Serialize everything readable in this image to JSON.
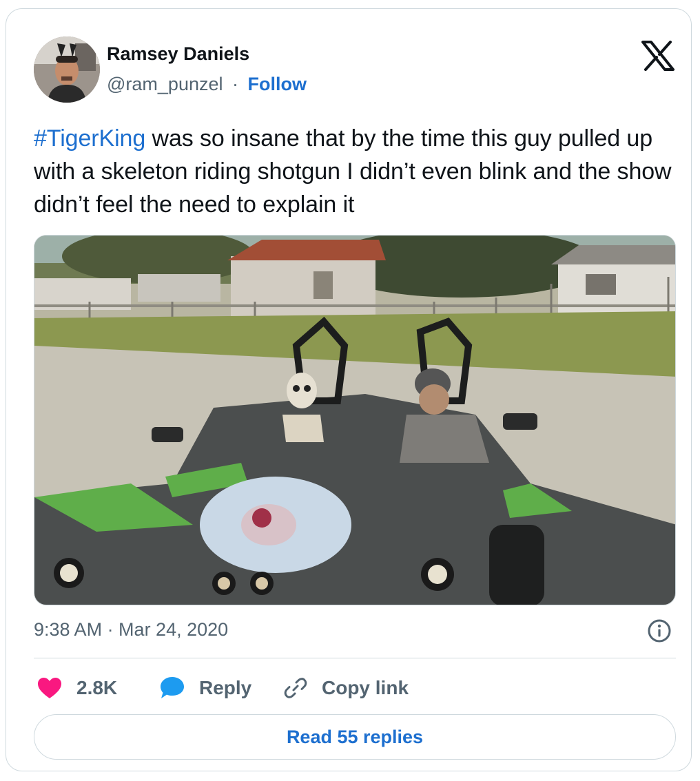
{
  "author": {
    "name": "Ramsey Daniels",
    "handle": "@ram_punzel",
    "separator": "·",
    "follow_label": "Follow"
  },
  "tweet": {
    "hashtag": "#TigerKing",
    "text_rest": " was so insane that by the time this guy pulled up with a skeleton riding shotgun I didn’t even blink and the show didn’t feel the need to explain it"
  },
  "timestamp": "9:38 AM · Mar 24, 2020",
  "actions": {
    "like_count": "2.8K",
    "reply_label": "Reply",
    "copy_link_label": "Copy link"
  },
  "read_replies_label": "Read 55 replies",
  "colors": {
    "link": "#1d6fcf",
    "like": "#f91880",
    "reply_bubble": "#1d9bf0",
    "muted": "#536471",
    "border": "#cfd9de"
  },
  "icons": [
    "x-logo-icon",
    "info-icon",
    "heart-icon",
    "reply-bubble-icon",
    "link-icon"
  ]
}
